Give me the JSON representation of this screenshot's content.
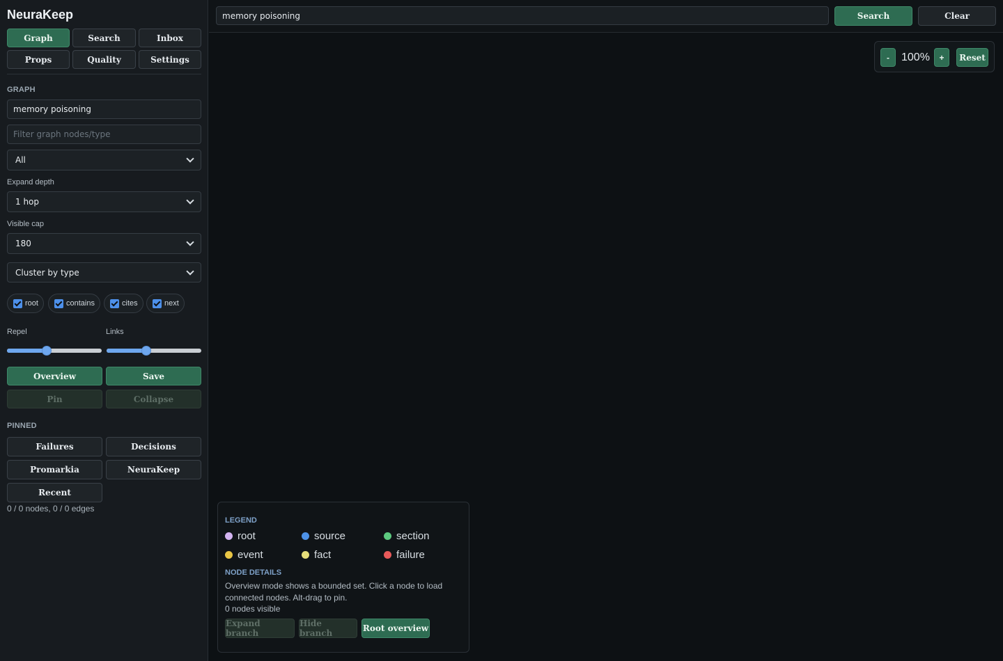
{
  "app": {
    "title": "NeuraKeep"
  },
  "nav": {
    "buttons": [
      "Graph",
      "Search",
      "Inbox",
      "Props",
      "Quality",
      "Settings"
    ]
  },
  "graph": {
    "section_title": "GRAPH",
    "query_value": "memory poisoning",
    "filter_placeholder": "Filter graph nodes/type",
    "type_select": "All",
    "depth_label": "Expand depth",
    "depth_select": "1 hop",
    "cap_label": "Visible cap",
    "cap_select": "180",
    "cluster_select": "Cluster by type",
    "edge_filters": [
      {
        "label": "root",
        "checked": true
      },
      {
        "label": "contains",
        "checked": true
      },
      {
        "label": "cites",
        "checked": true
      },
      {
        "label": "next",
        "checked": true
      }
    ],
    "repel_label": "Repel",
    "links_label": "Links",
    "repel_value": 0.41,
    "links_value": 0.41,
    "overview_button": "Overview",
    "save_button": "Save",
    "pin_button": "Pin",
    "collapse_button": "Collapse"
  },
  "pinned": {
    "section_title": "PINNED",
    "items": [
      "Failures",
      "Decisions",
      "Promarkia",
      "NeuraKeep",
      "Recent"
    ]
  },
  "counts": "0 / 0 nodes, 0 / 0 edges",
  "topbar": {
    "search_value": "memory poisoning",
    "search_button": "Search",
    "clear_button": "Clear"
  },
  "zoom": {
    "minus": "-",
    "level": "100%",
    "plus": "+",
    "reset": "Reset"
  },
  "legend": {
    "title": "LEGEND",
    "items": [
      {
        "label": "root",
        "color": "#d2b3f0"
      },
      {
        "label": "source",
        "color": "#4d92e8"
      },
      {
        "label": "section",
        "color": "#5cc97f"
      },
      {
        "label": "event",
        "color": "#e8c545"
      },
      {
        "label": "fact",
        "color": "#e6de7a"
      },
      {
        "label": "failure",
        "color": "#e85a5a"
      }
    ],
    "details_title": "NODE DETAILS",
    "details_text": "Overview mode shows a bounded set. Click a node to load connected nodes. Alt-drag to pin.",
    "nodes_visible": "0 nodes visible",
    "expand_button": "Expand branch",
    "hide_button": "Hide branch",
    "root_button": "Root overview"
  }
}
